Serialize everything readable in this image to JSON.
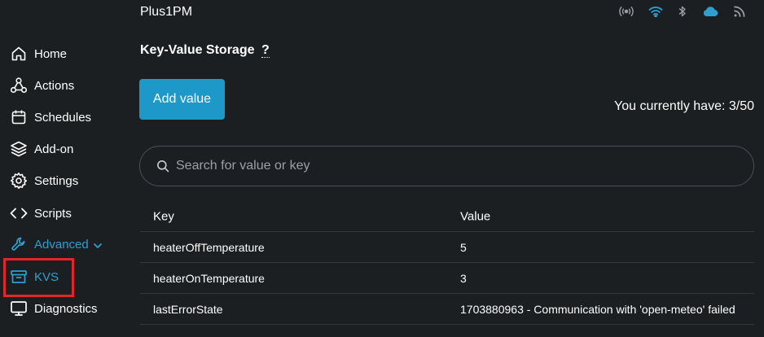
{
  "header": {
    "device_name": "Plus1PM",
    "icons": [
      "broadcast-icon",
      "wifi-icon",
      "bluetooth-icon",
      "cloud-icon",
      "rss-icon"
    ]
  },
  "sidebar": {
    "items": [
      {
        "label": "Home",
        "icon": "home-icon"
      },
      {
        "label": "Actions",
        "icon": "actions-icon"
      },
      {
        "label": "Schedules",
        "icon": "calendar-icon"
      },
      {
        "label": "Add-on",
        "icon": "layers-icon"
      },
      {
        "label": "Settings",
        "icon": "gear-icon"
      },
      {
        "label": "Scripts",
        "icon": "code-icon"
      },
      {
        "label": "Advanced",
        "icon": "wrench-icon"
      },
      {
        "label": "KVS",
        "icon": "archive-icon"
      },
      {
        "label": "Diagnostics",
        "icon": "monitor-icon"
      }
    ]
  },
  "main": {
    "title": "Key-Value Storage",
    "help": "?",
    "add_button": "Add value",
    "usage_text": "You currently have: 3/50",
    "search_placeholder": "Search for value or key",
    "table": {
      "columns": [
        "Key",
        "Value"
      ],
      "rows": [
        [
          "heaterOffTemperature",
          "5"
        ],
        [
          "heaterOnTemperature",
          "3"
        ],
        [
          "lastErrorState",
          "1703880963 - Communication with 'open-meteo' failed"
        ]
      ]
    }
  },
  "colors": {
    "background": "#1b1f22",
    "accent": "#2e9fd1",
    "button": "#1e98c9",
    "highlight": "#e0252b"
  }
}
